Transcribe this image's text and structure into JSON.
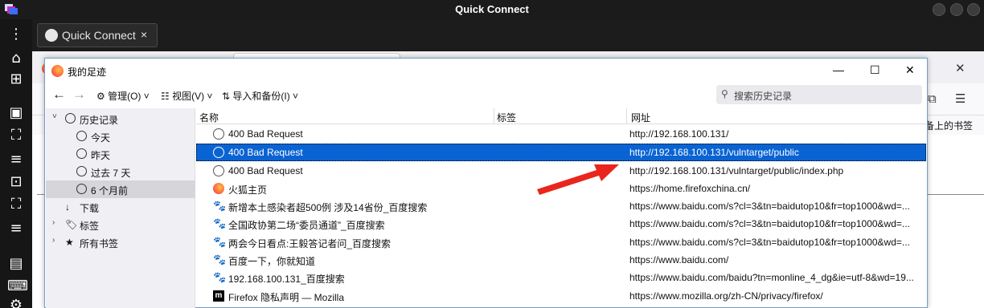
{
  "window": {
    "title": "Quick Connect"
  },
  "tab": {
    "label": "Quick Connect",
    "close": "×"
  },
  "browser": {
    "bookmarks_toolbar_text": "备上的书签"
  },
  "dialog": {
    "title": "我的足迹",
    "controls": {
      "minimize": "—",
      "maximize": "☐",
      "close": "✕"
    },
    "toolbar": {
      "back": "←",
      "forward": "→",
      "organize": "管理(O)",
      "views": "视图(V)",
      "import": "导入和备份(I)",
      "search_placeholder": "搜索历史记录"
    },
    "sidebar": [
      {
        "label": "历史记录",
        "expanded": true
      },
      {
        "label": "今天"
      },
      {
        "label": "昨天"
      },
      {
        "label": "过去 7 天"
      },
      {
        "label": "6 个月前",
        "selected": true
      },
      {
        "label": "下载"
      },
      {
        "label": "标签"
      },
      {
        "label": "所有书签"
      }
    ],
    "columns": {
      "name": "名称",
      "tags": "标签",
      "url": "网址"
    },
    "rows": [
      {
        "name": "400 Bad Request",
        "url": "http://192.168.100.131/",
        "icon": "globe-icon"
      },
      {
        "name": "400 Bad Request",
        "url": "http://192.168.100.131/vulntarget/public",
        "icon": "globe-icon",
        "selected": true
      },
      {
        "name": "400 Bad Request",
        "url": "http://192.168.100.131/vulntarget/public/index.php",
        "icon": "globe-icon"
      },
      {
        "name": "火狐主页",
        "url": "https://home.firefoxchina.cn/",
        "icon": "firefox-icon"
      },
      {
        "name": "新增本土感染者超500例 涉及14省份_百度搜索",
        "url": "https://www.baidu.com/s?cl=3&tn=baidutop10&fr=top1000&wd=...",
        "icon": "baidu-icon"
      },
      {
        "name": "全国政协第二场“委员通道”_百度搜索",
        "url": "https://www.baidu.com/s?cl=3&tn=baidutop10&fr=top1000&wd=...",
        "icon": "baidu-icon"
      },
      {
        "name": "两会今日看点:王毅答记者问_百度搜索",
        "url": "https://www.baidu.com/s?cl=3&tn=baidutop10&fr=top1000&wd=...",
        "icon": "baidu-icon"
      },
      {
        "name": "百度一下，你就知道",
        "url": "https://www.baidu.com/",
        "icon": "baidu-icon"
      },
      {
        "name": "192.168.100.131_百度搜索",
        "url": "https://www.baidu.com/baidu?tn=monline_4_dg&ie=utf-8&wd=19...",
        "icon": "baidu-icon"
      },
      {
        "name": "Firefox 隐私声明 — Mozilla",
        "url": "https://www.mozilla.org/zh-CN/privacy/firefox/",
        "icon": "mozilla-icon"
      }
    ]
  },
  "colors": {
    "selection": "#0a63d2",
    "annotation_arrow": "#e8261d"
  }
}
